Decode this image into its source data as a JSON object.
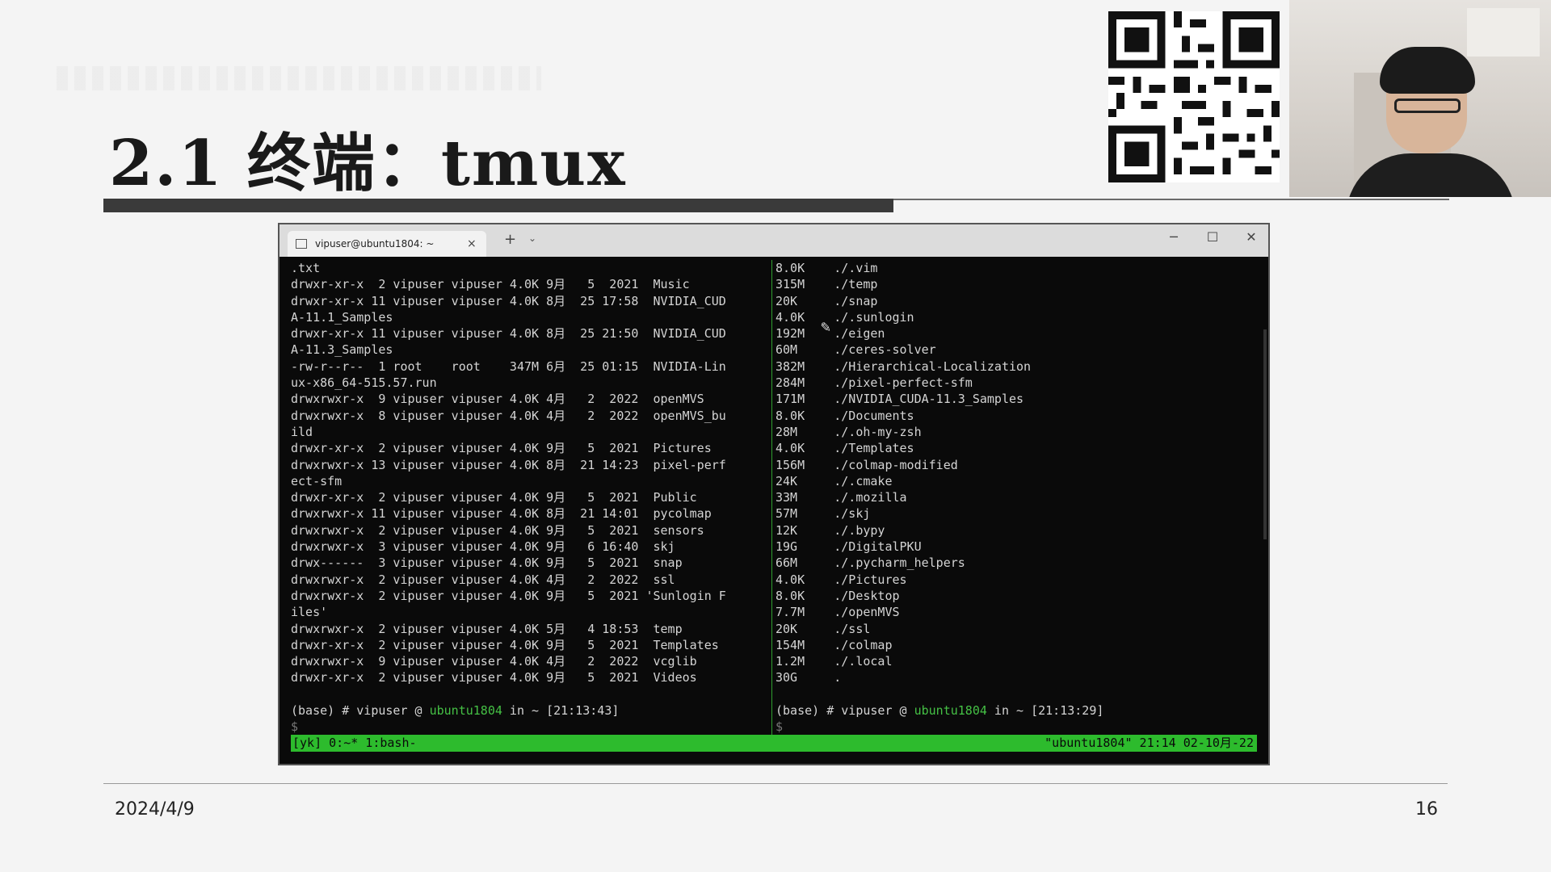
{
  "slide": {
    "title": "2.1 终端：tmux",
    "footer_date": "2024/4/9",
    "page_number": "16"
  },
  "terminal_window": {
    "tab_label": "vipuser@ubuntu1804: ~",
    "tab_close": "×",
    "new_tab": "+",
    "dropdown": "⌄",
    "minimize": "─",
    "maximize": "☐",
    "close": "✕"
  },
  "left_pane": {
    "lines": [
      ".txt",
      "drwxr-xr-x  2 vipuser vipuser 4.0K 9月   5  2021  Music",
      "drwxr-xr-x 11 vipuser vipuser 4.0K 8月  25 17:58  NVIDIA_CUD",
      "A-11.1_Samples",
      "drwxr-xr-x 11 vipuser vipuser 4.0K 8月  25 21:50  NVIDIA_CUD",
      "A-11.3_Samples",
      "-rw-r--r--  1 root    root    347M 6月  25 01:15  NVIDIA-Lin",
      "ux-x86_64-515.57.run",
      "drwxrwxr-x  9 vipuser vipuser 4.0K 4月   2  2022  openMVS",
      "drwxrwxr-x  8 vipuser vipuser 4.0K 4月   2  2022  openMVS_bu",
      "ild",
      "drwxr-xr-x  2 vipuser vipuser 4.0K 9月   5  2021  Pictures",
      "drwxrwxr-x 13 vipuser vipuser 4.0K 8月  21 14:23  pixel-perf",
      "ect-sfm",
      "drwxr-xr-x  2 vipuser vipuser 4.0K 9月   5  2021  Public",
      "drwxrwxr-x 11 vipuser vipuser 4.0K 8月  21 14:01  pycolmap",
      "drwxrwxr-x  2 vipuser vipuser 4.0K 9月   5  2021  sensors",
      "drwxrwxr-x  3 vipuser vipuser 4.0K 9月   6 16:40  skj",
      "drwx------  3 vipuser vipuser 4.0K 9月   5  2021  snap",
      "drwxrwxr-x  2 vipuser vipuser 4.0K 4月   2  2022  ssl",
      "drwxrwxr-x  2 vipuser vipuser 4.0K 9月   5  2021 'Sunlogin F",
      "iles'",
      "drwxrwxr-x  2 vipuser vipuser 4.0K 5月   4 18:53  temp",
      "drwxr-xr-x  2 vipuser vipuser 4.0K 9月   5  2021  Templates",
      "drwxrwxr-x  9 vipuser vipuser 4.0K 4月   2  2022  vcglib",
      "drwxr-xr-x  2 vipuser vipuser 4.0K 9月   5  2021  Videos"
    ],
    "prompt_prefix": "(base) # vipuser @ ",
    "prompt_host": "ubuntu1804",
    "prompt_suffix": " in ~ [21:13:43]",
    "cursor_line": "$ "
  },
  "right_pane": {
    "lines": [
      "8.0K    ./.vim",
      "315M    ./temp",
      "20K     ./snap",
      "4.0K    ./.sunlogin",
      "192M    ./eigen",
      "60M     ./ceres-solver",
      "382M    ./Hierarchical-Localization",
      "284M    ./pixel-perfect-sfm",
      "171M    ./NVIDIA_CUDA-11.3_Samples",
      "8.0K    ./Documents",
      "28M     ./.oh-my-zsh",
      "4.0K    ./Templates",
      "156M    ./colmap-modified",
      "24K     ./.cmake",
      "33M     ./.mozilla",
      "57M     ./skj",
      "12K     ./.bypy",
      "19G     ./DigitalPKU",
      "66M     ./.pycharm_helpers",
      "4.0K    ./Pictures",
      "8.0K    ./Desktop",
      "7.7M    ./openMVS",
      "20K     ./ssl",
      "154M    ./colmap",
      "1.2M    ./.local",
      "30G     ."
    ],
    "prompt_prefix": "(base) # vipuser @ ",
    "prompt_host": "ubuntu1804",
    "prompt_suffix": " in ~ [21:13:29]",
    "cursor_line": "$ "
  },
  "status_bar": {
    "left": "[yk] 0:~* 1:bash-",
    "right": "\"ubuntu1804\" 21:14 02-10月-22"
  },
  "icons": {
    "qr": "qr-code",
    "pencil": "pencil-icon",
    "terminal": "terminal-icon"
  }
}
